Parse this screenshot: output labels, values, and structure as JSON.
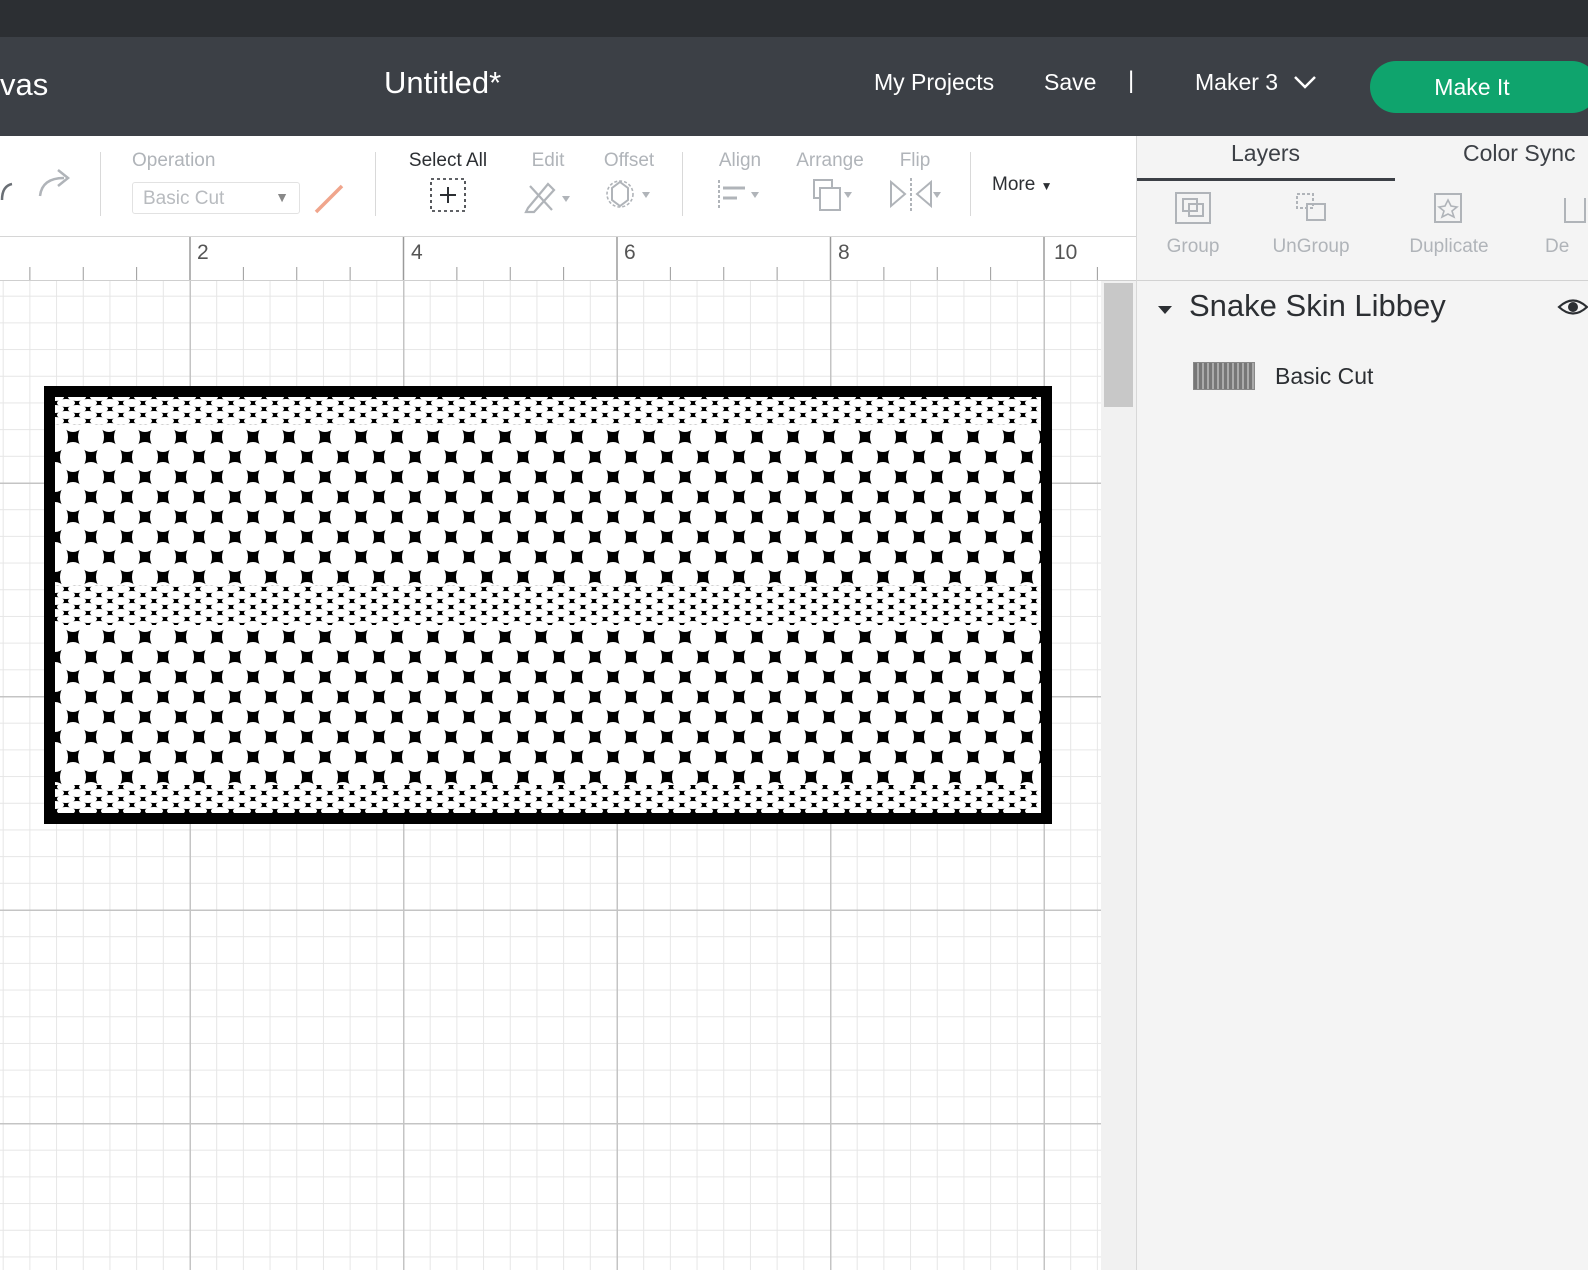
{
  "header": {
    "canvas_label": "vas",
    "title": "Untitled*",
    "my_projects": "My Projects",
    "save": "Save",
    "separator": "|",
    "machine": "Maker 3",
    "make_it": "Make It"
  },
  "toolbar": {
    "operation_label": "Operation",
    "operation_value": "Basic Cut",
    "select_all": "Select All",
    "edit": "Edit",
    "offset": "Offset",
    "align": "Align",
    "arrange": "Arrange",
    "flip": "Flip",
    "more": "More"
  },
  "ruler": {
    "marks": [
      "2",
      "4",
      "6",
      "8",
      "10"
    ]
  },
  "panel": {
    "tabs": {
      "layers": "Layers",
      "color_sync": "Color Sync"
    },
    "tools": {
      "group": "Group",
      "ungroup": "UnGroup",
      "duplicate": "Duplicate",
      "delete": "De"
    },
    "layer_group_name": "Snake Skin Libbey",
    "layer_item_name": "Basic Cut"
  },
  "colors": {
    "header_bg": "#3c4046",
    "top_strip": "#2c2f33",
    "make_it": "#0fa46d",
    "panel_bg": "#f4f4f4"
  }
}
